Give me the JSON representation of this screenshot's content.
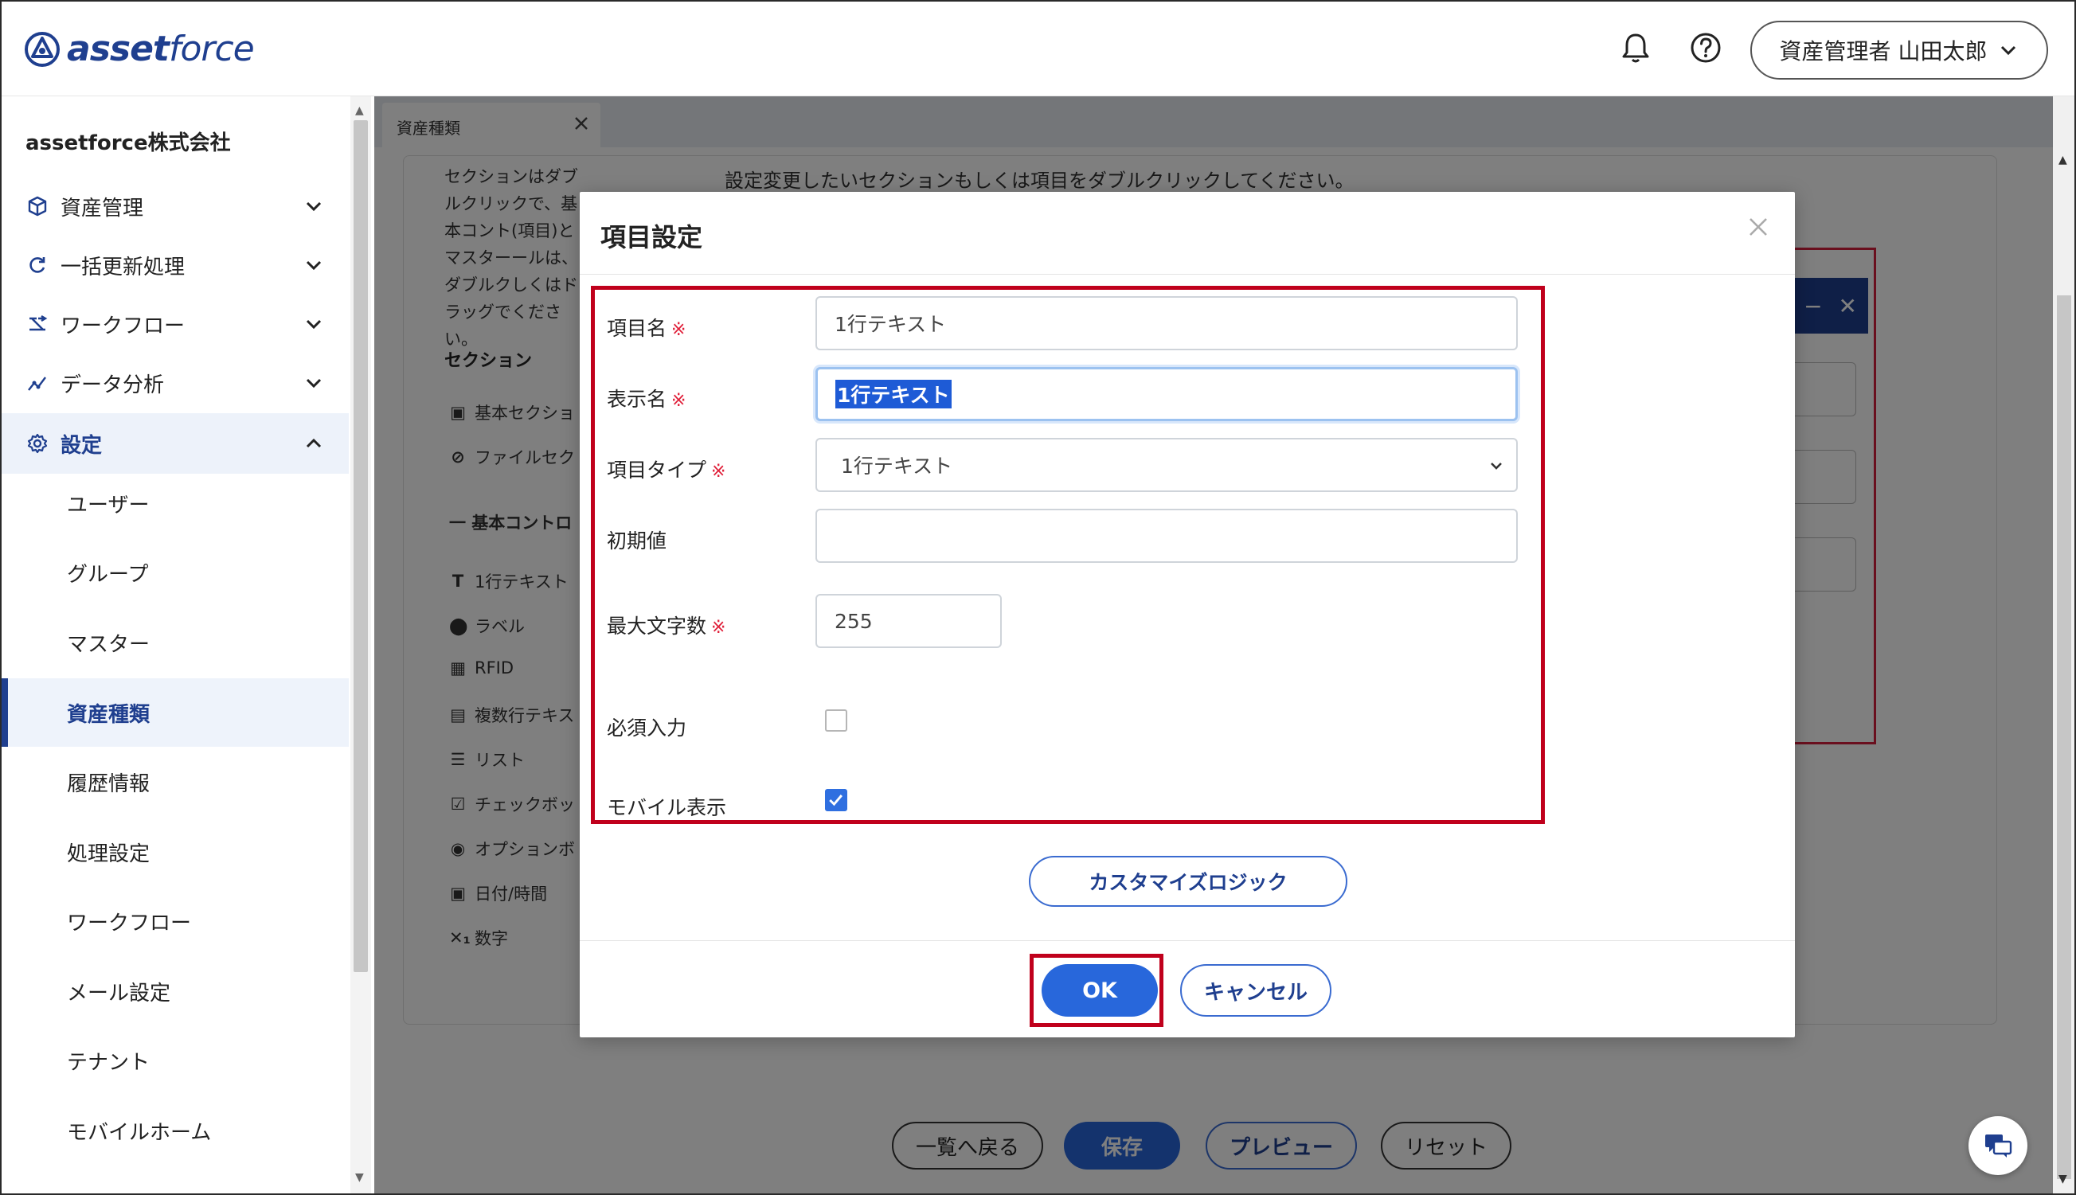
{
  "app": {
    "logo_text_bold": "asset",
    "logo_text_light": "force"
  },
  "header": {
    "user_label": "資産管理者 山田太郎"
  },
  "sidebar": {
    "company": "assetforce株式会社",
    "items": [
      {
        "label": "資産管理",
        "icon": "cube-icon"
      },
      {
        "label": "一括更新処理",
        "icon": "refresh-icon"
      },
      {
        "label": "ワークフロー",
        "icon": "workflow-icon"
      },
      {
        "label": "データ分析",
        "icon": "analytics-icon"
      },
      {
        "label": "設定",
        "icon": "gear-icon",
        "expanded": true
      }
    ],
    "sub_items": [
      "ユーザー",
      "グループ",
      "マスター",
      "資産種類",
      "履歴情報",
      "処理設定",
      "ワークフロー",
      "メール設定",
      "テナント",
      "モバイルホーム"
    ],
    "active_sub": "資産種類"
  },
  "tab": {
    "label": "資産種類"
  },
  "background": {
    "help_text": "セクションはダブルクリックで、基本コント(項目)とマスターールは、ダブルクしくはドラッグでください。",
    "section_heading": "セクション",
    "sections": [
      "基本セクショ",
      "ファイルセク"
    ],
    "controls_heading": "一 基本コントロ",
    "controls": [
      {
        "icon": "T",
        "label": "1行テキスト"
      },
      {
        "icon": "⬤",
        "label": "ラベル"
      },
      {
        "icon": "▦",
        "label": "RFID"
      },
      {
        "icon": "▤",
        "label": "複数行テキス"
      },
      {
        "icon": "☰",
        "label": "リスト"
      },
      {
        "icon": "☑",
        "label": "チェックボッ"
      },
      {
        "icon": "◉",
        "label": "オプションボ"
      },
      {
        "icon": "▣",
        "label": "日付/時間"
      },
      {
        "icon": "✕₁",
        "label": "数字"
      }
    ],
    "instruction": "設定変更したいセクションもしくは項目をダブルクリックしてください。",
    "bottom_buttons": {
      "back": "一覧へ戻る",
      "save": "保存",
      "preview": "プレビュー",
      "reset": "リセット"
    }
  },
  "modal": {
    "title": "項目設定",
    "required_mark": "※",
    "fields": {
      "item_name": {
        "label": "項目名",
        "value": "1行テキスト"
      },
      "display_name": {
        "label": "表示名",
        "value": "1行テキスト"
      },
      "item_type": {
        "label": "項目タイプ",
        "value": "1行テキスト"
      },
      "initial_value": {
        "label": "初期値",
        "value": ""
      },
      "max_length": {
        "label": "最大文字数",
        "value": "255"
      },
      "required": {
        "label": "必須入力",
        "checked": false
      },
      "mobile_display": {
        "label": "モバイル表示",
        "checked": true
      }
    },
    "custom_logic_label": "カスタマイズロジック",
    "ok_label": "OK",
    "cancel_label": "キャンセル"
  },
  "colors": {
    "brand": "#1f3f8f",
    "primary_button": "#2867db",
    "highlight_red": "#c0001c",
    "required_red": "#e0203a"
  }
}
